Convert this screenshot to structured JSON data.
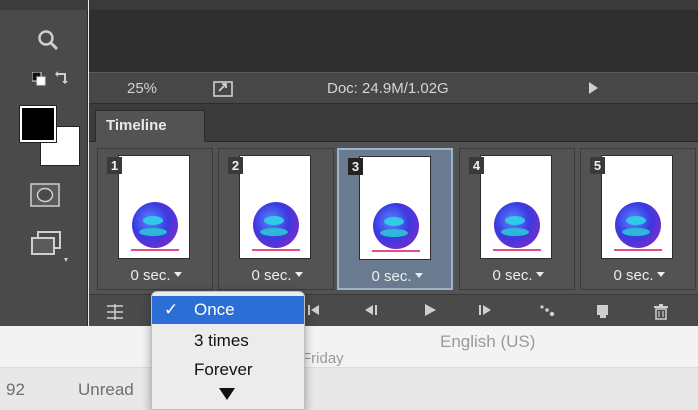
{
  "status_bar": {
    "zoom": "25%",
    "doc_info": "Doc: 24.9M/1.02G"
  },
  "panel": {
    "tab_label": "Timeline"
  },
  "frames": [
    {
      "number": "1",
      "delay": "0 sec.",
      "selected": false
    },
    {
      "number": "2",
      "delay": "0 sec.",
      "selected": false
    },
    {
      "number": "3",
      "delay": "0 sec.",
      "selected": true
    },
    {
      "number": "4",
      "delay": "0 sec.",
      "selected": false
    },
    {
      "number": "5",
      "delay": "0 sec.",
      "selected": false
    }
  ],
  "loop_menu": {
    "items": [
      {
        "label": "Once",
        "checked": true
      },
      {
        "label": "3 times",
        "checked": false
      },
      {
        "label": "Forever",
        "checked": false
      }
    ],
    "check_mark": "✓"
  },
  "background_window": {
    "row1_text": "English (US)",
    "row1_partial": "Friday",
    "row2_number": "92",
    "row2_text": "Unread"
  },
  "colors": {
    "selection_blue": "#2b6ed6",
    "selected_frame": "#6a7b8f"
  }
}
